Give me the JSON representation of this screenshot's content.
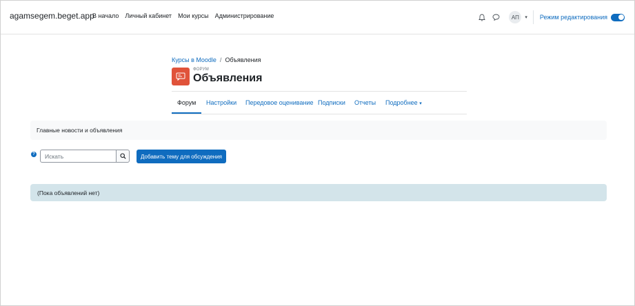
{
  "navbar": {
    "brand": "agamsegem.beget.app",
    "items": [
      {
        "label": "В начало"
      },
      {
        "label": "Личный кабинет"
      },
      {
        "label": "Мои курсы"
      },
      {
        "label": "Администрирование"
      }
    ],
    "avatar_initials": "АП",
    "edit_mode_label": "Режим редактирования",
    "edit_mode_on": true
  },
  "breadcrumb": {
    "parent": "Курсы в Moodle",
    "separator": "/",
    "current": "Объявления"
  },
  "header": {
    "activity_type": "ФОРУМ",
    "title": "Объявления",
    "icon_color": "#e0533a"
  },
  "tabs": [
    {
      "label": "Форум",
      "active": true
    },
    {
      "label": "Настройки"
    },
    {
      "label": "Передовое оценивание"
    },
    {
      "label": "Подписки"
    },
    {
      "label": "Отчеты"
    },
    {
      "label": "Подробнее"
    }
  ],
  "intro": {
    "text": "Главные новости и объявления"
  },
  "search": {
    "placeholder": "Искать"
  },
  "add_topic": {
    "label": "Добавить тему для обсуждения"
  },
  "alert": {
    "text": "(Пока объявлений нет)"
  },
  "colors": {
    "primary": "#0f6cbf",
    "alert_bg": "#d3e4ea",
    "intro_bg": "#f8f9fa"
  }
}
